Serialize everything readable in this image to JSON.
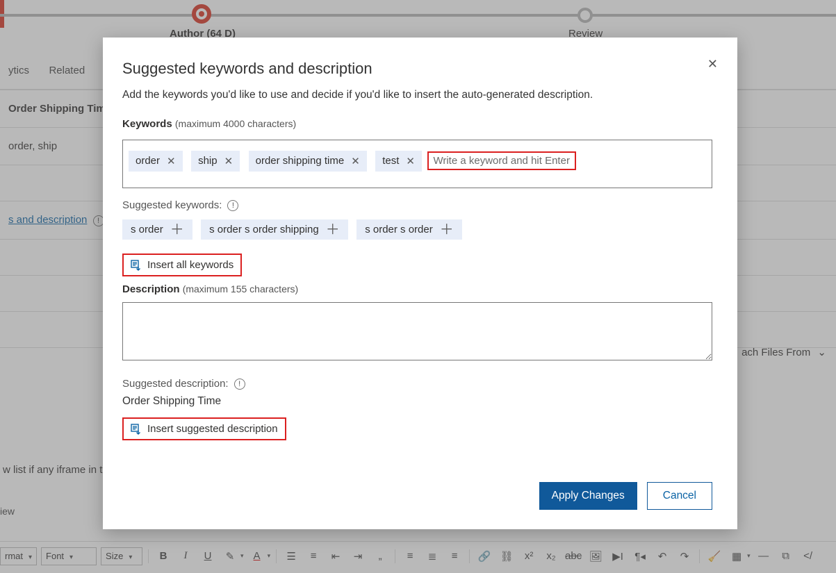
{
  "progress": {
    "step1_label": "Author  (64 D)",
    "step2_label": "Review"
  },
  "bg_tabs": [
    "ytics",
    "Related"
  ],
  "bg_rows": {
    "title": "Order Shipping Time",
    "keywords_line": "order, ship",
    "link_text": "s and description",
    "attach_label": "ach Files From",
    "iframe_text": "w list if any iframe in t",
    "view_text": "iew"
  },
  "toolbar": {
    "format": "rmat",
    "font": "Font",
    "size": "Size"
  },
  "modal": {
    "title": "Suggested keywords and description",
    "intro": "Add the keywords you'd like to use and decide if you'd like to insert the auto-generated description.",
    "keywords_label": "Keywords",
    "keywords_hint": "(maximum 4000 characters)",
    "keyword_chips": [
      "order",
      "ship",
      "order shipping time",
      "test"
    ],
    "keyword_input_placeholder": "Write a keyword and hit Enter",
    "suggested_keywords_label": "Suggested keywords:",
    "suggested_chips": [
      "s order",
      "s order s order shipping",
      "s order s order"
    ],
    "insert_all_label": "Insert all keywords",
    "description_label": "Description",
    "description_hint": "(maximum 155 characters)",
    "description_value": "",
    "suggested_description_label": "Suggested description:",
    "suggested_description_text": "Order Shipping Time",
    "insert_suggested_label": "Insert suggested description",
    "apply_label": "Apply Changes",
    "cancel_label": "Cancel"
  }
}
